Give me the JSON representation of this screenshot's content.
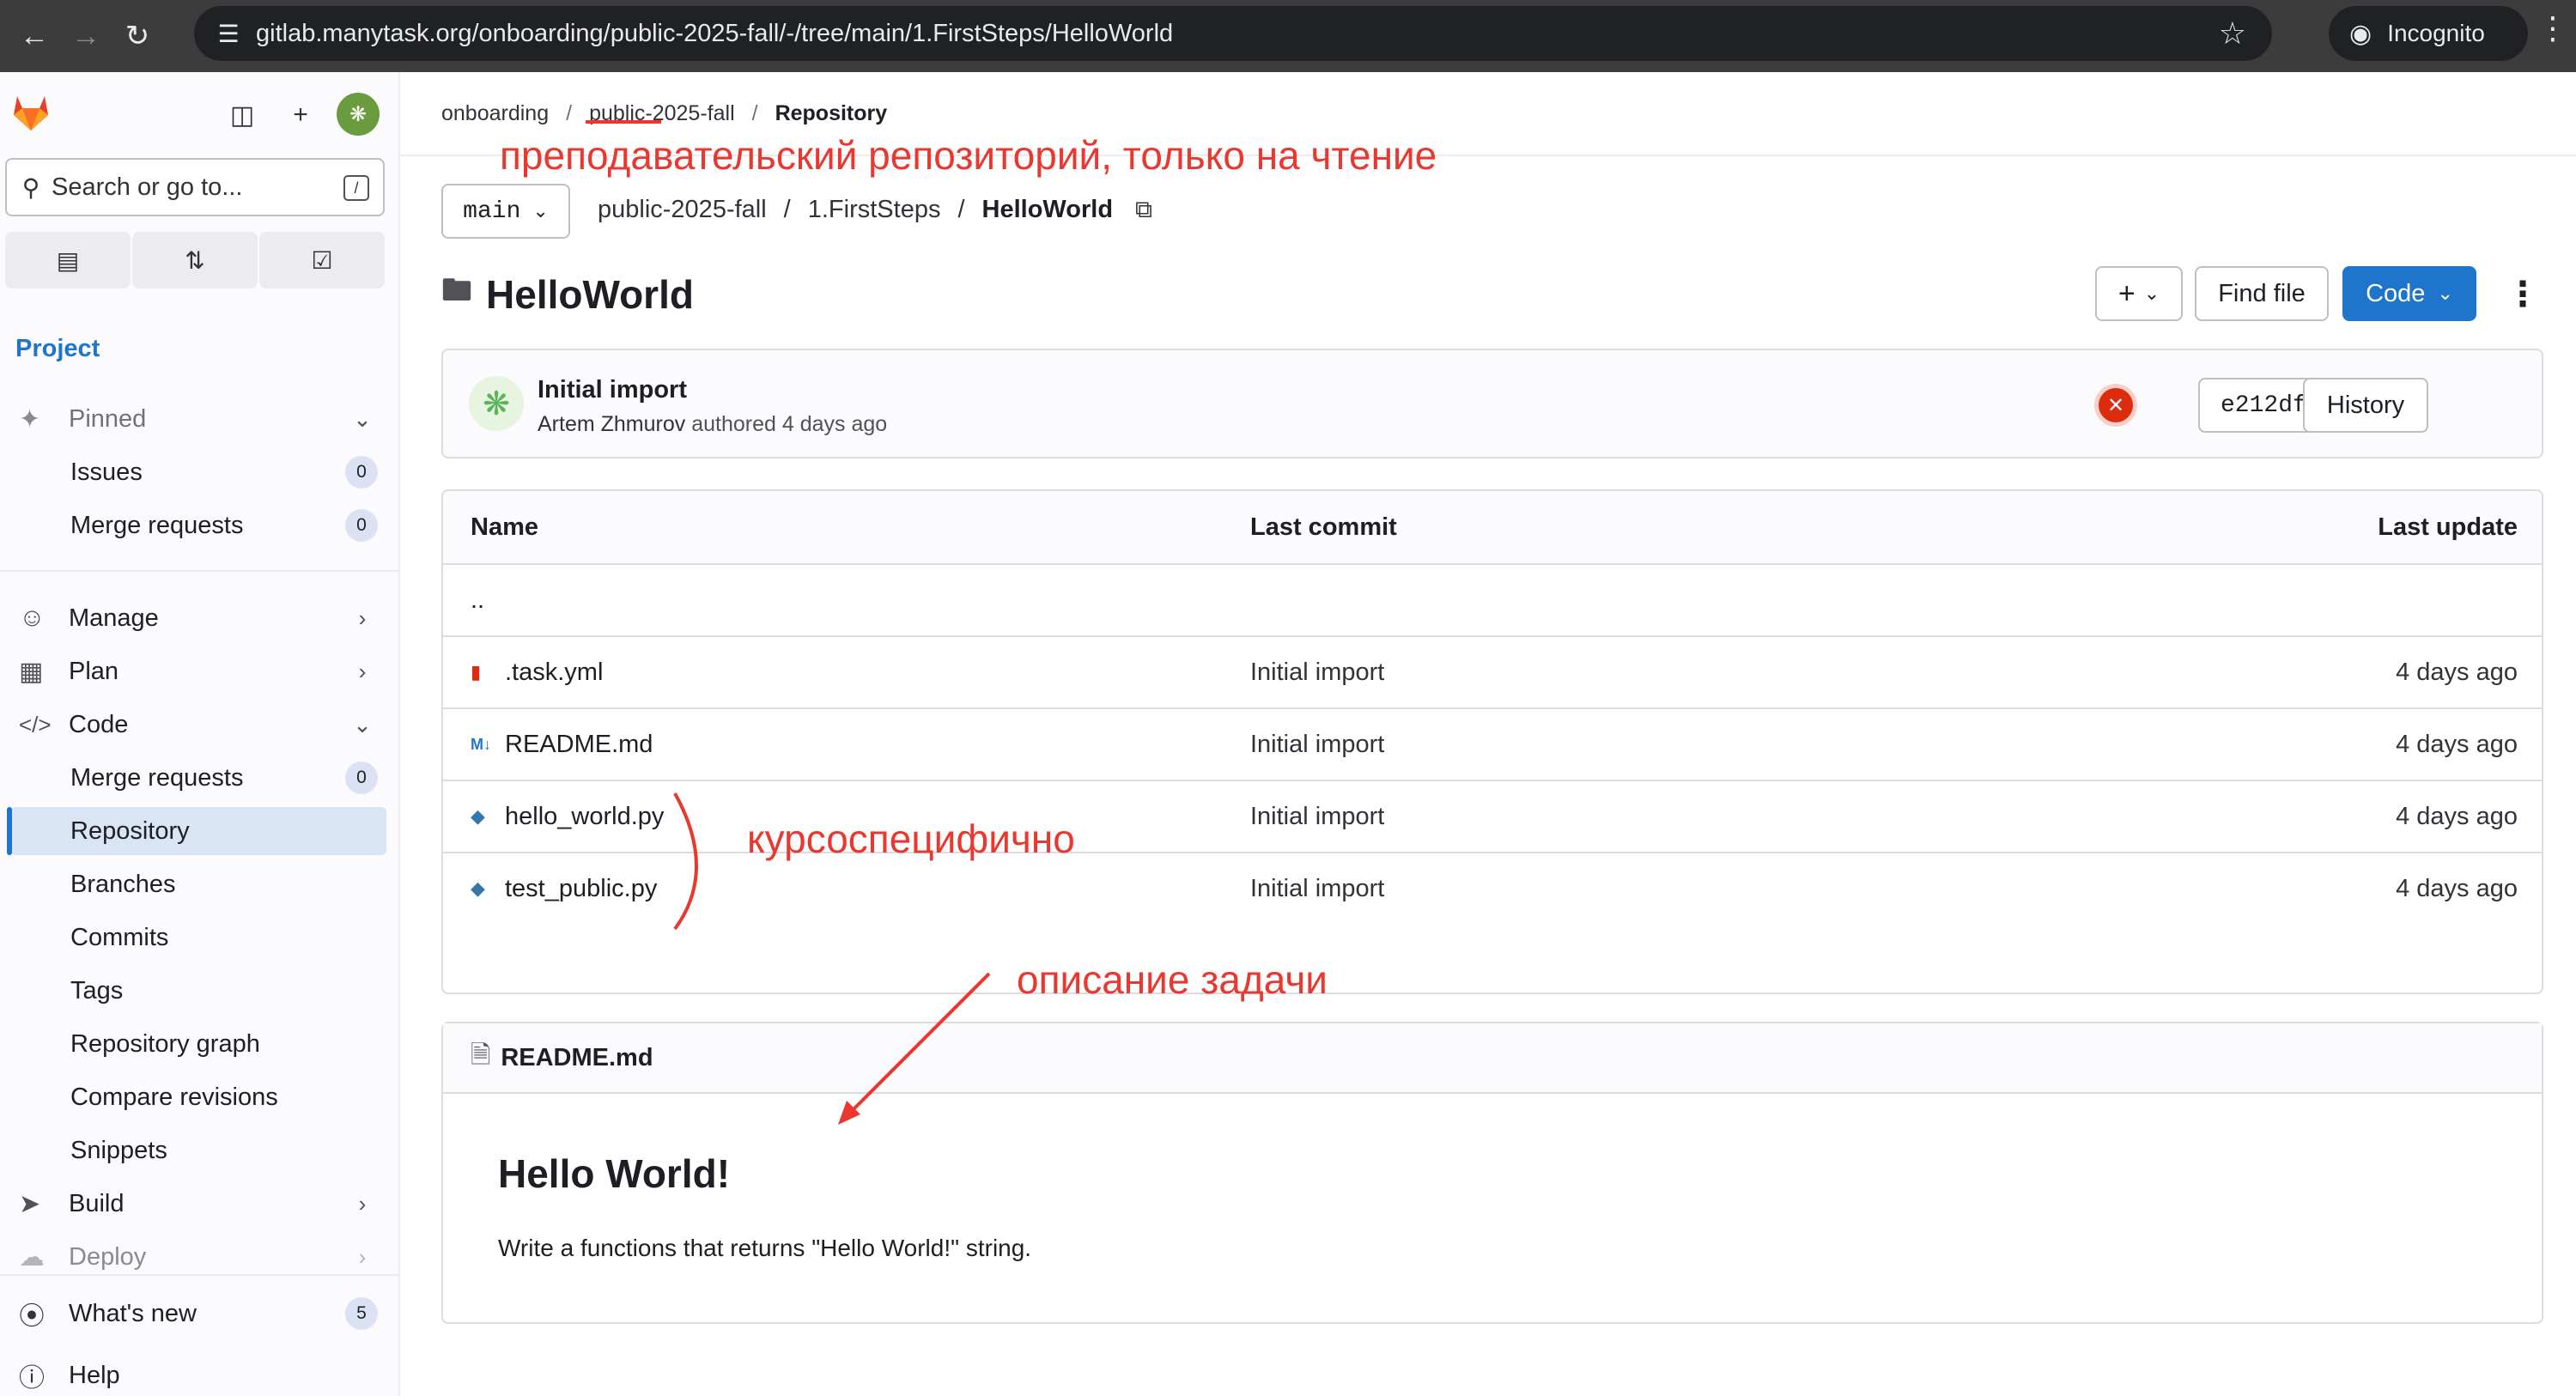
{
  "browser": {
    "url": "gitlab.manytask.org/onboarding/public-2025-fall/-/tree/main/1.FirstSteps/HelloWorld",
    "incognito_label": "Incognito"
  },
  "sidebar": {
    "search_placeholder": "Search or go to...",
    "search_shortcut": "/",
    "section_title": "Project",
    "pinned": {
      "label": "Pinned",
      "items": [
        {
          "label": "Issues",
          "count": "0"
        },
        {
          "label": "Merge requests",
          "count": "0"
        }
      ]
    },
    "manage": "Manage",
    "plan": "Plan",
    "code": {
      "label": "Code",
      "items": [
        {
          "label": "Merge requests",
          "count": "0"
        },
        {
          "label": "Repository"
        },
        {
          "label": "Branches"
        },
        {
          "label": "Commits"
        },
        {
          "label": "Tags"
        },
        {
          "label": "Repository graph"
        },
        {
          "label": "Compare revisions"
        },
        {
          "label": "Snippets"
        }
      ]
    },
    "build": "Build",
    "deploy": "Deploy",
    "whats_new": {
      "label": "What's new",
      "count": "5"
    },
    "help": "Help"
  },
  "breadcrumb": [
    "onboarding",
    "public-2025-fall",
    "Repository"
  ],
  "branch": "main",
  "path": [
    "public-2025-fall",
    "1.FirstSteps",
    "HelloWorld"
  ],
  "title": "HelloWorld",
  "buttons": {
    "find_file": "Find file",
    "code": "Code",
    "history": "History"
  },
  "commit": {
    "title": "Initial import",
    "author": "Artem Zhmurov",
    "meta_rest": "authored 4 days ago",
    "sha": "e212df30"
  },
  "table": {
    "headers": {
      "name": "Name",
      "last_commit": "Last commit",
      "last_update": "Last update"
    },
    "parent": "..",
    "rows": [
      {
        "name": ".task.yml",
        "icon": "yaml-file-icon",
        "commit": "Initial import",
        "updated": "4 days ago"
      },
      {
        "name": "README.md",
        "icon": "markdown-file-icon",
        "commit": "Initial import",
        "updated": "4 days ago"
      },
      {
        "name": "hello_world.py",
        "icon": "python-file-icon",
        "commit": "Initial import",
        "updated": "4 days ago"
      },
      {
        "name": "test_public.py",
        "icon": "python-file-icon",
        "commit": "Initial import",
        "updated": "4 days ago"
      }
    ]
  },
  "readme": {
    "filename": "README.md",
    "heading": "Hello World!",
    "body": "Write a functions that returns \"Hello World!\" string."
  },
  "annotations": {
    "read_only": "преподавательский репозиторий, только на чтение",
    "course_specific": "курсоспецифично",
    "task_description": "описание задачи",
    "color": "#e8382f"
  }
}
